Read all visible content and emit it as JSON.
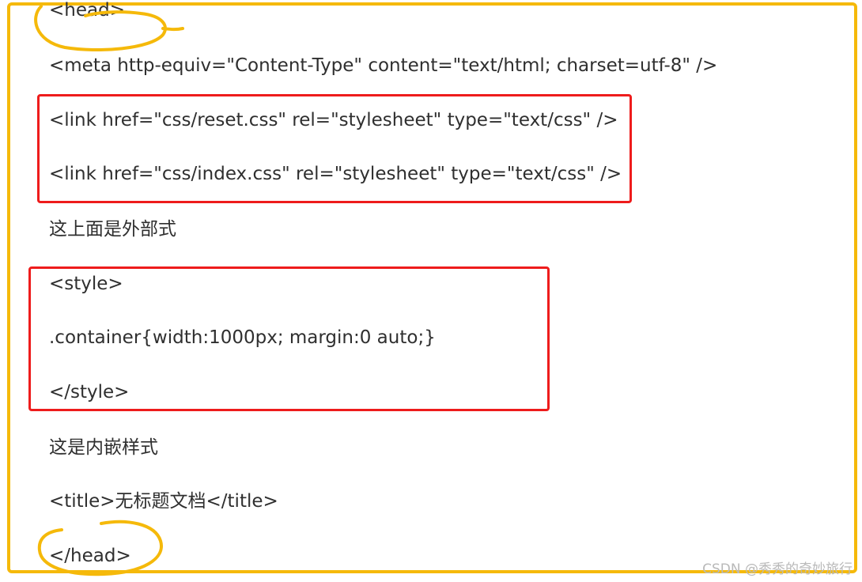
{
  "lines": {
    "head_open": "<head>",
    "meta": "<meta http-equiv=\"Content-Type\" content=\"text/html; charset=utf-8\" />",
    "link_reset": "<link href=\"css/reset.css\" rel=\"stylesheet\" type=\"text/css\" />",
    "link_index": "<link href=\"css/index.css\" rel=\"stylesheet\" type=\"text/css\" />",
    "external_note": "这上面是外部式",
    "style_open": "<style>",
    "container_rule": ".container{width:1000px; margin:0 auto;}",
    "style_close": "</style>",
    "embedded_note": "这是内嵌样式",
    "title": "<title>无标题文档</title>",
    "head_close": "</head>"
  },
  "watermark": "CSDN @秀秀的奇妙旅行",
  "colors": {
    "frame": "#f5b90a",
    "highlight_box": "#ee1c1c",
    "text": "#2f2f2f"
  }
}
